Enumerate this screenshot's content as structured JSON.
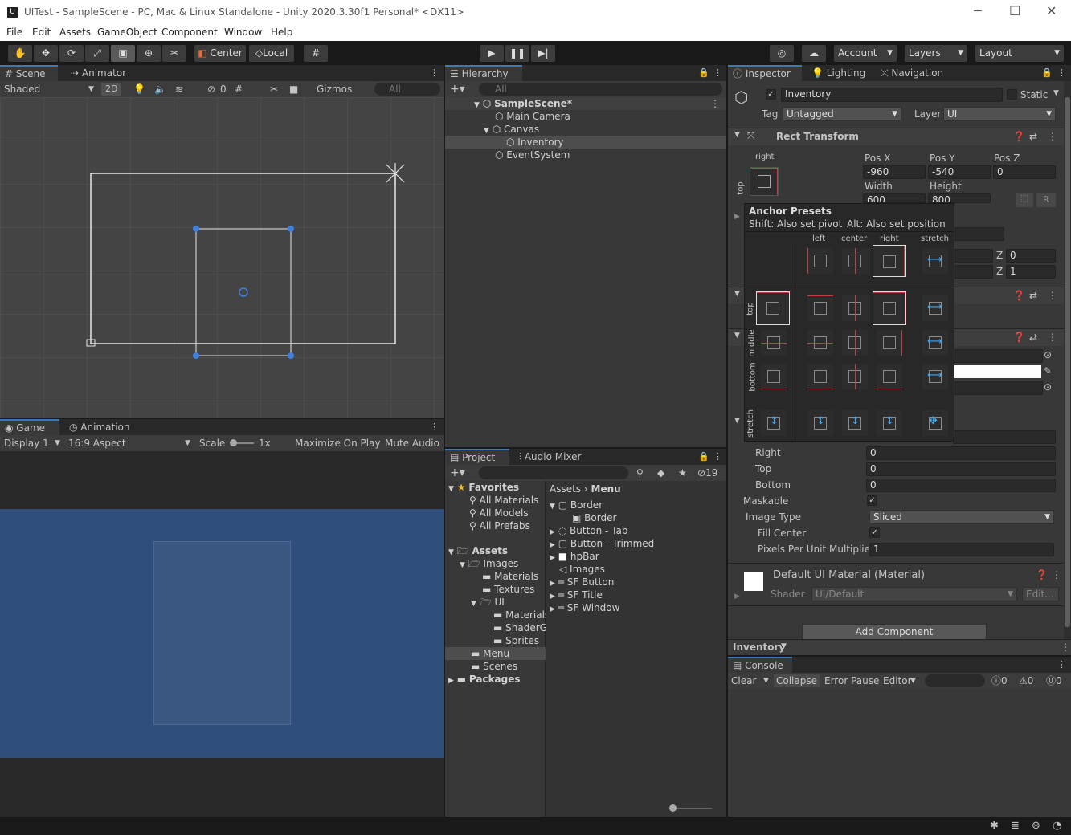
{
  "window": {
    "title": "UITest - SampleScene - PC, Mac & Linux Standalone - Unity 2020.3.30f1 Personal* <DX11>",
    "logo": "U",
    "minimize": "─",
    "maximize": "☐",
    "close": "✕"
  },
  "menu": [
    "File",
    "Edit",
    "Assets",
    "GameObject",
    "Component",
    "Window",
    "Help"
  ],
  "toolbar": {
    "pivot": "Center",
    "space": "Local",
    "account": "Account",
    "layers": "Layers",
    "layout": "Layout"
  },
  "scene": {
    "tab": "Scene",
    "tab2": "Animator",
    "shading": "Shaded",
    "mode2d": "2D",
    "hidden_count": "0",
    "gizmos": "Gizmos",
    "search_placeholder": "All"
  },
  "game": {
    "tab": "Game",
    "tab2": "Animation",
    "display": "Display 1",
    "aspect": "16:9 Aspect",
    "scale_label": "Scale",
    "scale": "1x",
    "maximize": "Maximize On Play",
    "mute": "Mute Audio"
  },
  "hierarchy": {
    "tab": "Hierarchy",
    "search_placeholder": "All",
    "items": [
      {
        "label": "SampleScene*"
      },
      {
        "label": "Main Camera"
      },
      {
        "label": "Canvas"
      },
      {
        "label": "Inventory"
      },
      {
        "label": "EventSystem"
      }
    ]
  },
  "project": {
    "tab": "Project",
    "tab2": "Audio Mixer",
    "hidden_count": "19",
    "favorites": {
      "title": "Favorites",
      "items": [
        "All Materials",
        "All Models",
        "All Prefabs"
      ]
    },
    "assets_tree": {
      "title": "Assets",
      "items": [
        "Images",
        "Materials",
        "Textures",
        "UI",
        "Materials",
        "ShaderG",
        "Sprites",
        "Menu",
        "Scenes"
      ]
    },
    "packages": "Packages",
    "breadcrumb": [
      "Assets",
      "Menu"
    ],
    "files": [
      "Border",
      "Border",
      "Button - Tab",
      "Button - Trimmed",
      "hpBar",
      "Images",
      "SF Button",
      "SF Title",
      "SF Window"
    ]
  },
  "inspector": {
    "tab": "Inspector",
    "tab2": "Lighting",
    "tab3": "Navigation",
    "object_name": "Inventory",
    "static_label": "Static",
    "tag_label": "Tag",
    "tag": "Untagged",
    "layer_label": "Layer",
    "layer": "UI",
    "rect": {
      "title": "Rect Transform",
      "anchor_h": "right",
      "anchor_v": "top",
      "posx_label": "Pos X",
      "posy_label": "Pos Y",
      "posz_label": "Pos Z",
      "posx": "-960",
      "posy": "-540",
      "posz": "0",
      "width_label": "Width",
      "height_label": "Height",
      "width": "600",
      "height": "800",
      "r_label": "R",
      "z_label1": "Z",
      "z_val1": "0",
      "z_label2": "Z",
      "z_val2": "1"
    },
    "image": {
      "right_label": "Right",
      "right": "0",
      "top_label": "Top",
      "top": "0",
      "bottom_label": "Bottom",
      "bottom": "0",
      "maskable_label": "Maskable",
      "image_type_label": "Image Type",
      "image_type": "Sliced",
      "fill_center_label": "Fill Center",
      "ppu_label": "Pixels Per Unit Multiplier",
      "ppu": "1"
    },
    "material": {
      "title": "Default UI Material (Material)",
      "shader_label": "Shader",
      "shader": "UI/Default",
      "edit": "Edit..."
    },
    "add_component": "Add Component",
    "footer": "Inventory"
  },
  "anchor_presets": {
    "title": "Anchor Presets",
    "shift_hint": "Shift: Also set pivot",
    "alt_hint": "Alt: Also set position",
    "cols": [
      "left",
      "center",
      "right",
      "stretch"
    ],
    "rows": [
      "top",
      "middle",
      "bottom",
      "stretch"
    ]
  },
  "console": {
    "tab": "Console",
    "clear": "Clear",
    "collapse": "Collapse",
    "error_pause": "Error Pause",
    "editor": "Editor",
    "info_count": "0",
    "warn_count": "0",
    "error_count": "0"
  }
}
